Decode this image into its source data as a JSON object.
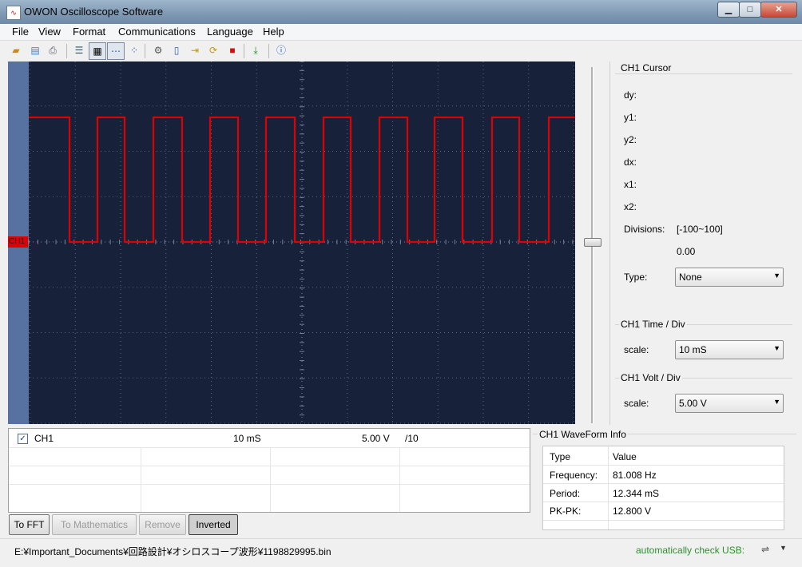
{
  "window": {
    "title": "OWON Oscilloscope Software"
  },
  "menu": [
    "File",
    "View",
    "Format",
    "Communications",
    "Language",
    "Help"
  ],
  "toolbar": {
    "buttons": [
      "open-icon",
      "save-icon",
      "print-icon",
      "list-icon",
      "grid-icon",
      "dots-icon",
      "cursor-icon",
      "settings-icon",
      "battery-icon",
      "import-icon",
      "refresh-icon",
      "stop-icon",
      "export-icon",
      "help-icon"
    ]
  },
  "scope": {
    "marker": "CH1",
    "colors": {
      "background": "#18213a",
      "trace": "#e00000",
      "grid": "#8a94ad"
    },
    "waveform": {
      "type": "square",
      "rises": [
        23,
        86,
        156,
        227,
        297,
        369,
        439,
        508,
        580,
        651
      ],
      "falls": [
        51,
        120,
        192,
        262,
        333,
        403,
        474,
        543,
        614,
        685
      ],
      "level_high_div": 2.75,
      "level_low_div": 0
    }
  },
  "cursor": {
    "title": "CH1 Cursor",
    "fields": [
      "dy:",
      "y1:",
      "y2:",
      "dx:",
      "x1:",
      "x2:"
    ],
    "divisions_label": "Divisions:",
    "divisions_range": "[-100~100]",
    "divisions_value": "0.00",
    "type_label": "Type:",
    "type_value": "None"
  },
  "time_div": {
    "title": "CH1 Time / Div",
    "scale_label": "scale:",
    "value": "10 mS"
  },
  "volt_div": {
    "title": "CH1 Volt / Div",
    "scale_label": "scale:",
    "value": "5.00 V"
  },
  "channel_list": {
    "rows": [
      {
        "checked": true,
        "name": "CH1",
        "time": "10 mS",
        "volt": "5.00 V",
        "probe": "/10"
      }
    ]
  },
  "buttons": {
    "fft": "To FFT",
    "math": "To Mathematics",
    "remove": "Remove",
    "inverted": "Inverted"
  },
  "waveform_info": {
    "title": "CH1 WaveForm Info",
    "headers": [
      "Type",
      "Value"
    ],
    "rows": [
      {
        "type": "Frequency:",
        "value": "81.008 Hz"
      },
      {
        "type": "Period:",
        "value": "12.344 mS"
      },
      {
        "type": "PK-PK:",
        "value": "12.800 V"
      }
    ]
  },
  "status": {
    "path": "E:¥Important_Documents¥回路設計¥オシロスコープ波形¥1198829995.bin",
    "usb": "automatically check USB:"
  }
}
